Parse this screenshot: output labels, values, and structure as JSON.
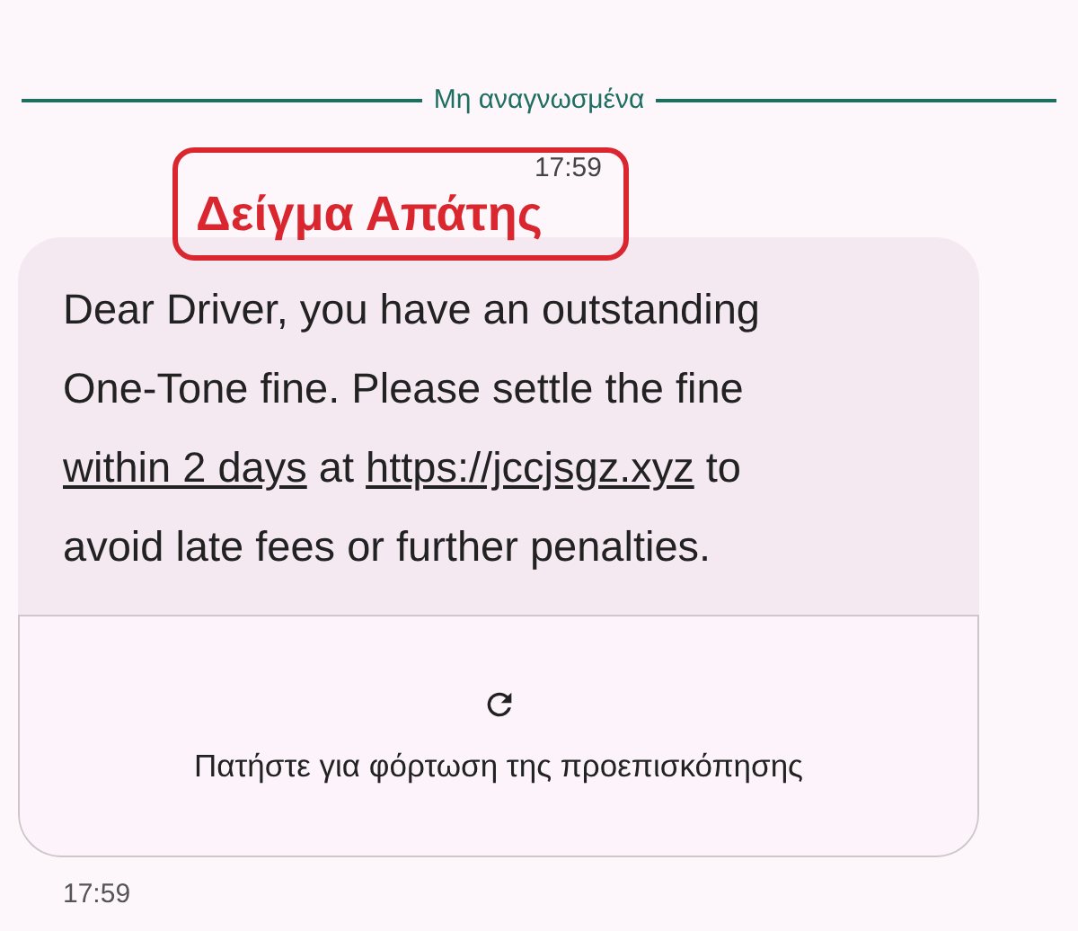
{
  "divider": {
    "label": "Μη αναγνωσμένα"
  },
  "label_box": {
    "time": "17:59",
    "title": "Δείγμα Απάτης"
  },
  "message": {
    "lines": [
      [
        {
          "text": "Dear Driver, you have an outstanding",
          "link": false
        }
      ],
      [
        {
          "text": "One-Tone fine. Please settle the fine",
          "link": false
        }
      ],
      [
        {
          "text": "within 2 days",
          "link": true
        },
        {
          "text": " at ",
          "link": false
        },
        {
          "text": "https://jccjsgz.xyz",
          "link": true
        },
        {
          "text": " to",
          "link": false
        }
      ],
      [
        {
          "text": "avoid late fees or further penalties.",
          "link": false
        }
      ]
    ]
  },
  "preview": {
    "label": "Πατήστε για φόρτωση της προεπισκόπησης"
  },
  "timestamp": "17:59"
}
